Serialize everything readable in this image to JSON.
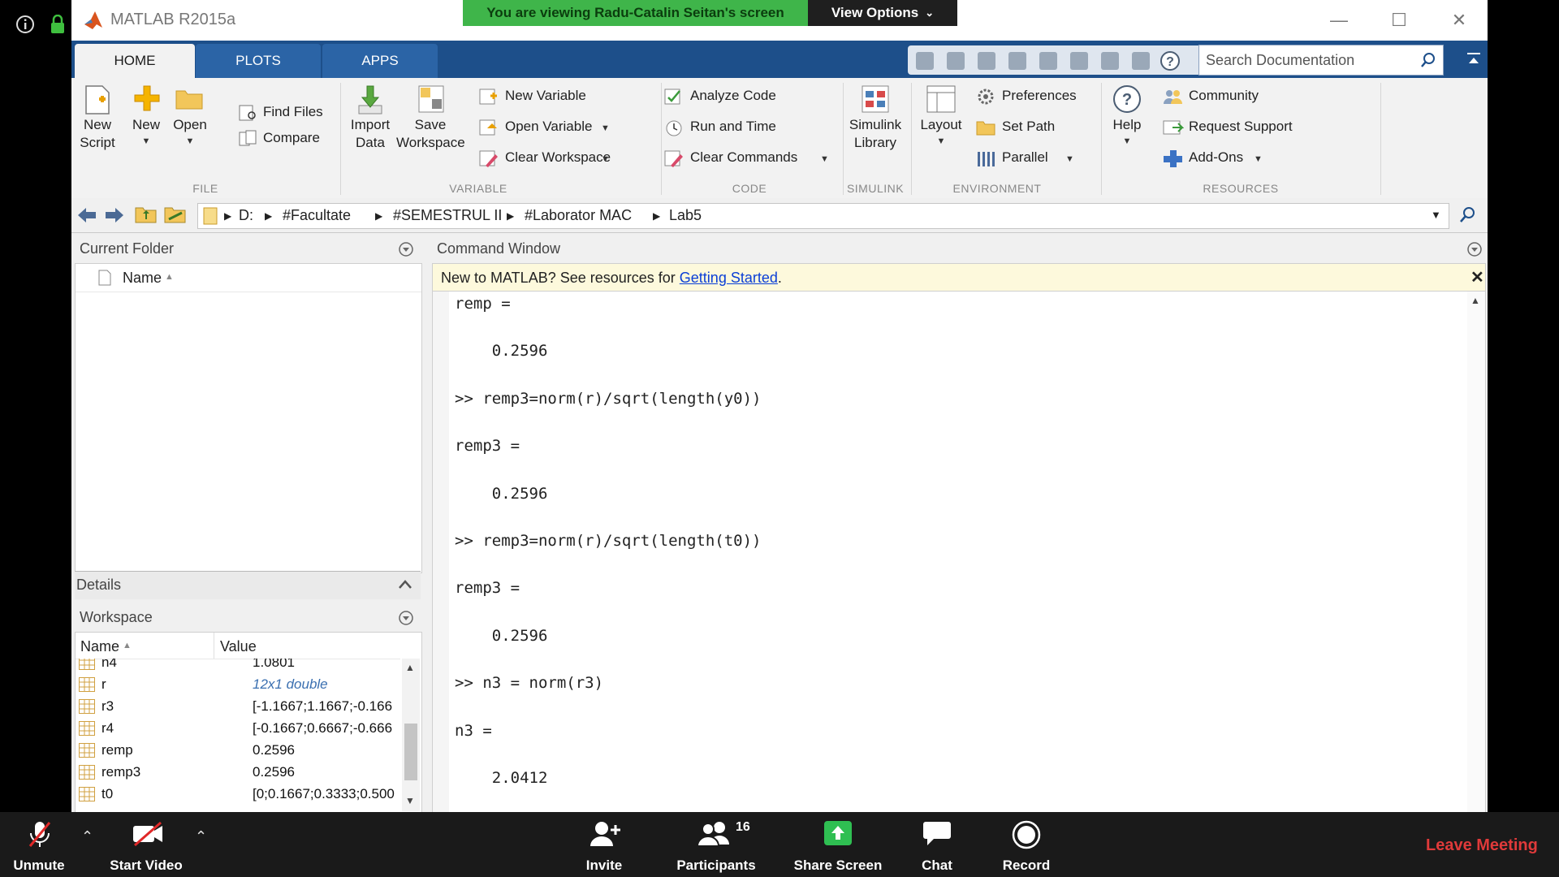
{
  "zoom": {
    "share_banner": "You are viewing Radu-Catalin Seitan's screen",
    "view_options": "View Options",
    "bottom": {
      "unmute": "Unmute",
      "start_video": "Start Video",
      "invite": "Invite",
      "participants": "Participants",
      "participant_count": "16",
      "share_screen": "Share Screen",
      "chat": "Chat",
      "record": "Record",
      "leave": "Leave Meeting"
    }
  },
  "matlab": {
    "title": "MATLAB R2015a",
    "tabs": [
      "HOME",
      "PLOTS",
      "APPS"
    ],
    "search_placeholder": "Search Documentation",
    "ribbon": {
      "file": {
        "section": "FILE",
        "new_script": "New\nScript",
        "new_script_a": "New",
        "new_script_b": "Script",
        "new": "New",
        "open": "Open",
        "find_files": "Find Files",
        "compare": "Compare"
      },
      "variable": {
        "section": "VARIABLE",
        "import_a": "Import",
        "import_b": "Data",
        "save_a": "Save",
        "save_b": "Workspace",
        "new_variable": "New Variable",
        "open_variable": "Open Variable",
        "clear_workspace": "Clear Workspace"
      },
      "code": {
        "section": "CODE",
        "analyze_code": "Analyze Code",
        "run_and_time": "Run and Time",
        "clear_commands": "Clear Commands"
      },
      "simulink": {
        "section": "SIMULINK",
        "lib_a": "Simulink",
        "lib_b": "Library"
      },
      "environment": {
        "section": "ENVIRONMENT",
        "layout": "Layout",
        "preferences": "Preferences",
        "set_path": "Set Path",
        "parallel": "Parallel"
      },
      "resources": {
        "section": "RESOURCES",
        "help": "Help",
        "community": "Community",
        "request_support": "Request Support",
        "add_ons": "Add-Ons"
      }
    },
    "path": [
      "D:",
      "#Facultate",
      "#SEMESTRUL II",
      "#Laborator MAC",
      "Lab5"
    ],
    "current_folder": {
      "title": "Current Folder",
      "name_col": "Name"
    },
    "details": "Details",
    "workspace": {
      "title": "Workspace",
      "name_col": "Name",
      "value_col": "Value",
      "rows": [
        {
          "name": "n4",
          "value": "1.0801",
          "italic": false
        },
        {
          "name": "r",
          "value": "12x1 double",
          "italic": true
        },
        {
          "name": "r3",
          "value": "[-1.1667;1.1667;-0.166",
          "italic": false
        },
        {
          "name": "r4",
          "value": "[-0.1667;0.6667;-0.666",
          "italic": false
        },
        {
          "name": "remp",
          "value": "0.2596",
          "italic": false
        },
        {
          "name": "remp3",
          "value": "0.2596",
          "italic": false
        },
        {
          "name": "t0",
          "value": "[0;0.1667;0.3333;0.500",
          "italic": false
        }
      ]
    },
    "command_window": {
      "title": "Command Window",
      "notice_prefix": "New to MATLAB? See resources for ",
      "notice_link": "Getting Started",
      "notice_suffix": ".",
      "lines": [
        "remp =",
        "",
        "    0.2596",
        "",
        ">> remp3=norm(r)/sqrt(length(y0))",
        "",
        "remp3 =",
        "",
        "    0.2596",
        "",
        ">> remp3=norm(r)/sqrt(length(t0))",
        "",
        "remp3 =",
        "",
        "    0.2596",
        "",
        ">> n3 = norm(r3)",
        "",
        "n3 =",
        "",
        "    2.0412"
      ]
    }
  }
}
